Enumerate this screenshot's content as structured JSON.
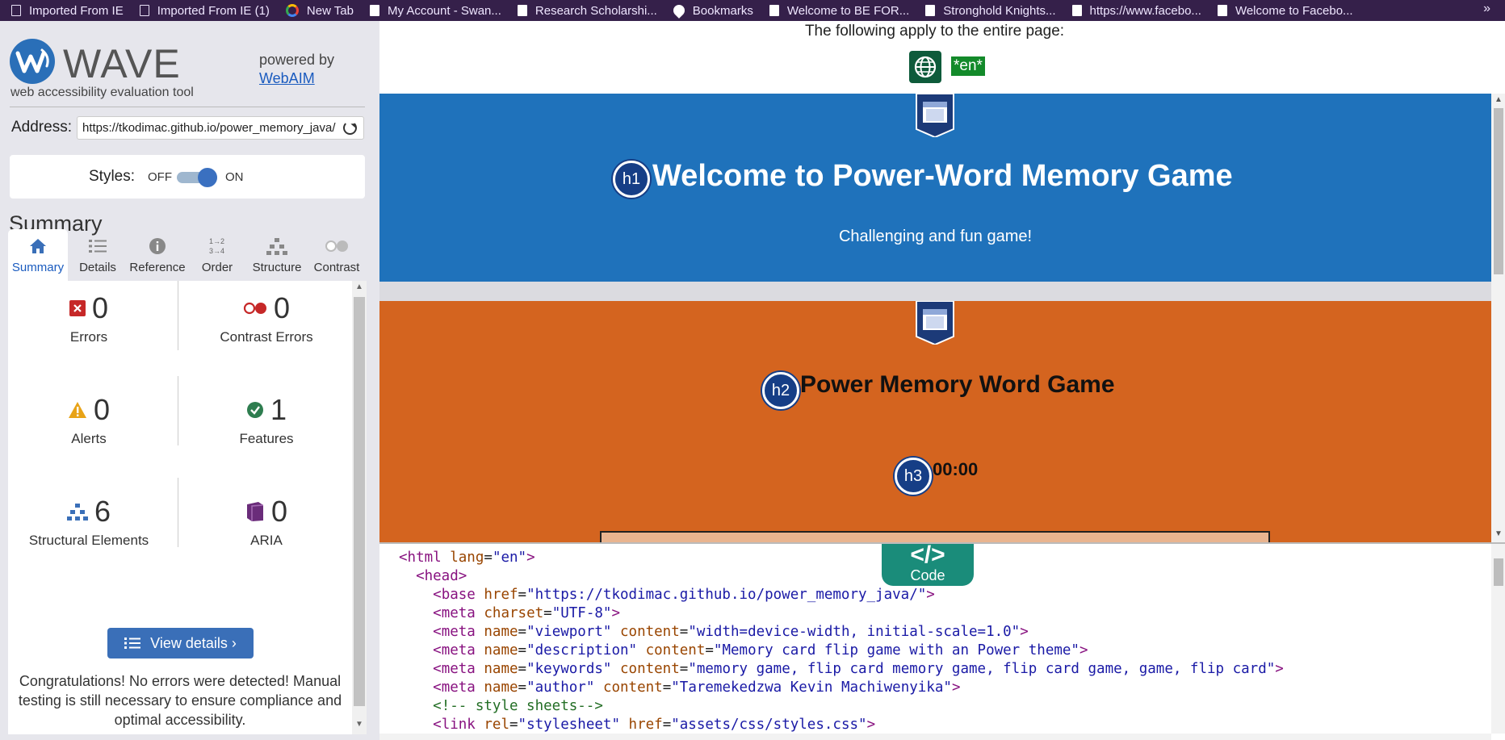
{
  "bookmarks": [
    {
      "label": "Imported From IE",
      "icon": "folder-icon"
    },
    {
      "label": "Imported From IE (1)",
      "icon": "folder-icon"
    },
    {
      "label": "New Tab",
      "icon": "google-icon"
    },
    {
      "label": "My Account - Swan...",
      "icon": "page-icon"
    },
    {
      "label": "Research Scholarshi...",
      "icon": "page-icon"
    },
    {
      "label": "Bookmarks",
      "icon": "heart-icon"
    },
    {
      "label": "Welcome to BE FOR...",
      "icon": "page-icon"
    },
    {
      "label": "Stronghold Knights...",
      "icon": "page-icon"
    },
    {
      "label": "https://www.facebo...",
      "icon": "page-icon"
    },
    {
      "label": "Welcome to Facebo...",
      "icon": "page-icon"
    }
  ],
  "bookmarks_more": "»",
  "wave": {
    "title": "WAVE",
    "tagline": "web accessibility evaluation tool",
    "powered_by": "powered by",
    "webaim": "WebAIM",
    "address_label": "Address:",
    "address_value": "https://tkodimac.github.io/power_memory_java/",
    "styles_label": "Styles:",
    "styles_off": "OFF",
    "styles_on": "ON",
    "styles_state": "on",
    "summary_heading": "Summary",
    "tabs": [
      {
        "label": "Summary",
        "icon": "home-icon",
        "active": true
      },
      {
        "label": "Details",
        "icon": "list-icon",
        "active": false
      },
      {
        "label": "Reference",
        "icon": "info-icon",
        "active": false
      },
      {
        "label": "Order",
        "icon": "order-icon",
        "active": false
      },
      {
        "label": "Structure",
        "icon": "structure-icon",
        "active": false
      },
      {
        "label": "Contrast",
        "icon": "contrast-icon",
        "active": false
      }
    ],
    "stats": {
      "errors": {
        "count": "0",
        "label": "Errors"
      },
      "contrast_errors": {
        "count": "0",
        "label": "Contrast Errors"
      },
      "alerts": {
        "count": "0",
        "label": "Alerts"
      },
      "features": {
        "count": "1",
        "label": "Features"
      },
      "structural": {
        "count": "6",
        "label": "Structural Elements"
      },
      "aria": {
        "count": "0",
        "label": "ARIA"
      }
    },
    "view_details": "View details ›",
    "congrats": "Congratulations! No errors were detected! Manual testing is still necessary to ensure compliance and optimal accessibility."
  },
  "preview": {
    "page_note": "The following apply to the entire page:",
    "lang_badge": "*en*",
    "h1_badge": "h1",
    "h1_text": "Welcome to Power-Word Memory Game",
    "subtitle": "Challenging and fun game!",
    "h2_badge": "h2",
    "h2_text": "Power Memory Word Game",
    "h3_badge": "h3",
    "h3_text": "00:00"
  },
  "code": {
    "tab_symbol": "</>",
    "tab_label": "Code"
  },
  "colors": {
    "header_blue": "#1f72bb",
    "section_orange": "#d4641f",
    "heading_badge": "#163e86",
    "lang_green": "#138a2a",
    "code_tab": "#1a8c7a"
  }
}
